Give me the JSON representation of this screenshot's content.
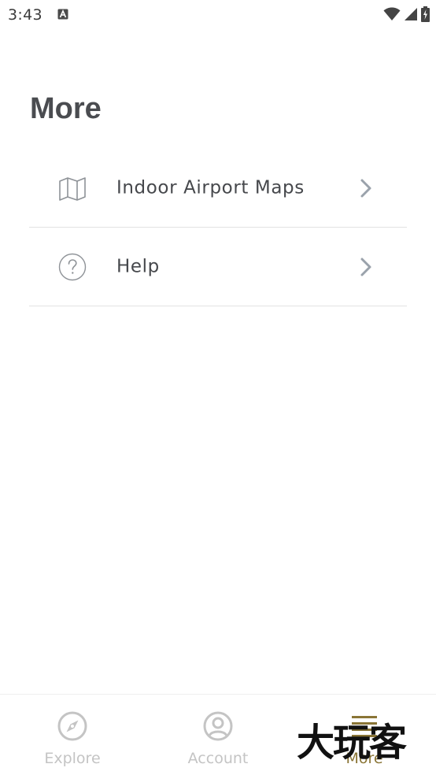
{
  "status_bar": {
    "time": "3:43",
    "notification_icon": "a-letter-icon",
    "wifi_icon": "wifi-icon",
    "signal_icon": "cellular-signal-icon",
    "battery_icon": "battery-charging-icon"
  },
  "page": {
    "title": "More"
  },
  "menu": {
    "items": [
      {
        "label": "Indoor Airport Maps",
        "icon": "map-icon"
      },
      {
        "label": "Help",
        "icon": "help-circle-icon"
      }
    ]
  },
  "bottom_nav": {
    "items": [
      {
        "label": "Explore",
        "icon": "compass-icon",
        "active": false
      },
      {
        "label": "Account",
        "icon": "account-circle-icon",
        "active": false
      },
      {
        "label": "More",
        "icon": "menu-lines-icon",
        "active": true
      }
    ],
    "active_color": "#8a7536",
    "inactive_color": "#c4c4c4"
  },
  "watermark": {
    "text": "大玩客"
  },
  "colors": {
    "title": "#4a4c50",
    "label": "#46484c",
    "chevron": "#9aa2ab",
    "divider": "#e2e2e2"
  }
}
